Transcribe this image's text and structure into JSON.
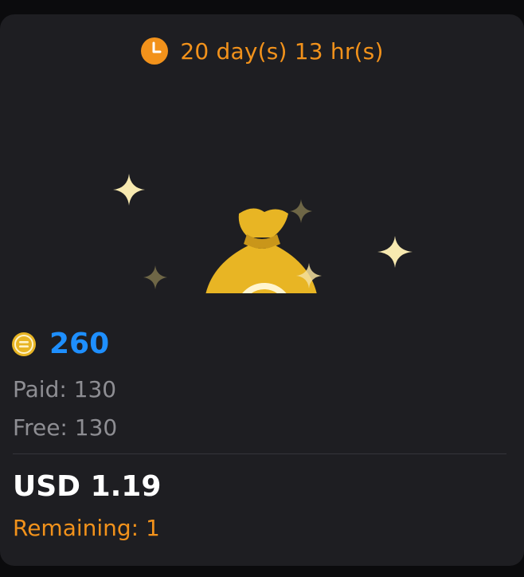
{
  "timer": {
    "icon": "clock-icon",
    "text": "20 day(s) 13 hr(s)"
  },
  "illustration": {
    "icon": "money-bag-icon",
    "sparkles": "sparkle-icon"
  },
  "balance": {
    "icon": "coin-icon",
    "amount": "260",
    "paid": "Paid: 130",
    "free": "Free: 130"
  },
  "price": {
    "label": "USD 1.19",
    "remaining": "Remaining: 1"
  },
  "colors": {
    "accent_orange": "#f2921b",
    "amount_blue": "#1e8fff",
    "bag_gold": "#e8b524",
    "card_background": "#1e1e22",
    "muted_text": "#8e8e93"
  }
}
